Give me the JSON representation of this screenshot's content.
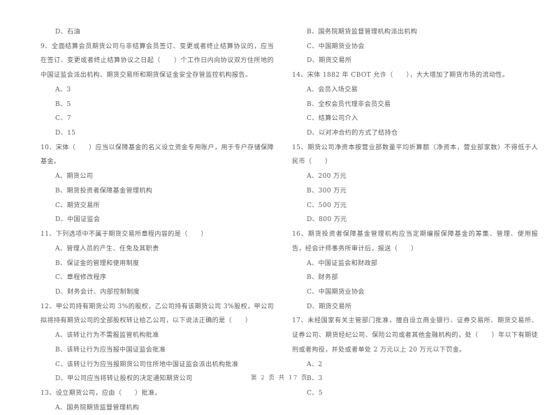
{
  "document": {
    "page_label": "第 2 页 共 17 页",
    "background_color": "#ffffff",
    "text_color": "#5a5a5a"
  },
  "left_column": {
    "items": [
      {
        "kind": "option",
        "text": "D、石油"
      },
      {
        "kind": "stem",
        "text": "9、全面结算会员期货公司与非结算会员签订、变更或者终止结算协议的，应当在签订、变更或者终止结算协议之日起（　　）个工作日内向协议双方住所地的中国证监会派出机构、期货交易所和期货保证金安全存管监控机构报告。"
      },
      {
        "kind": "option",
        "text": "A、3"
      },
      {
        "kind": "option",
        "text": "B、5"
      },
      {
        "kind": "option",
        "text": "C、7"
      },
      {
        "kind": "option",
        "text": "D、15"
      },
      {
        "kind": "stem",
        "text": "10、宋体（　　）应当以保障基金的名义设立资金专用账户，用于专户存储保障基金。"
      },
      {
        "kind": "option",
        "text": "A、期货公司"
      },
      {
        "kind": "option",
        "text": "B、期货投资者保障基金管理机构"
      },
      {
        "kind": "option",
        "text": "C、期货交易所"
      },
      {
        "kind": "option",
        "text": "D、中国证监会"
      },
      {
        "kind": "stem",
        "text": "11、下列选项中不属于期货交易所章程内容的是（　　）"
      },
      {
        "kind": "option",
        "text": "A、管理人员的产生、任免及其职责"
      },
      {
        "kind": "option",
        "text": "B、保证金的管理和使用制度"
      },
      {
        "kind": "option",
        "text": "C、章程修改程序"
      },
      {
        "kind": "option",
        "text": "D、财务会计、内部控制制度"
      },
      {
        "kind": "stem",
        "text": "12、甲公司持有期货公司 3%的股权，乙公司持有该期货公司 3%股权，甲公司拟将持有期货公司的全部股权转让给乙公司，以下说法正确的是（　　）"
      },
      {
        "kind": "option",
        "text": "A、该转让行为不需报监管机构批准"
      },
      {
        "kind": "option",
        "text": "B、该转让行为应当报中国证监会批准"
      },
      {
        "kind": "option",
        "text": "C、该转让行为应当报期货公司住所地中国证监会派出机构批准"
      },
      {
        "kind": "option",
        "text": "D、甲公司应当将转让股权的决定通知期货公司"
      },
      {
        "kind": "stem",
        "text": "13、设立期货公司，应由（　　）批准。"
      },
      {
        "kind": "option",
        "text": "A、国务院期货监督管理机构"
      }
    ]
  },
  "right_column": {
    "items": [
      {
        "kind": "option",
        "text": "B、国务院期货监督管理机构派出机构"
      },
      {
        "kind": "option",
        "text": "C、中国期货业协会"
      },
      {
        "kind": "option",
        "text": "D、期货交易所"
      },
      {
        "kind": "stem",
        "text": "14、宋体 1882 年 CBOT 允许（　　），大大增加了期货市场的流动性。"
      },
      {
        "kind": "option",
        "text": "A、会员入场交易"
      },
      {
        "kind": "option",
        "text": "B、全权会员代理非会员交易"
      },
      {
        "kind": "option",
        "text": "C、结算公司介入"
      },
      {
        "kind": "option",
        "text": "D、以对冲合约的方式了结持仓"
      },
      {
        "kind": "stem",
        "text": "15、期货公司净资本按营业部数量平均折算额（净资本，营业部家数）不得低于人民币（　　）"
      },
      {
        "kind": "option",
        "text": "A、200 万元"
      },
      {
        "kind": "option",
        "text": "B、300 万元"
      },
      {
        "kind": "option",
        "text": "C、500 万元"
      },
      {
        "kind": "option",
        "text": "D、800 万元"
      },
      {
        "kind": "stem",
        "text": "16、期货投资者保障基金管理机构应当定期编报保障基金的筹集、管理、使用报告，经会计师事务所审计后，报送（　　）"
      },
      {
        "kind": "option",
        "text": "A、中国证监会和财政部"
      },
      {
        "kind": "option",
        "text": "B、财务部"
      },
      {
        "kind": "option",
        "text": "C、中国期货业协会"
      },
      {
        "kind": "option",
        "text": "D、期货交易所"
      },
      {
        "kind": "stem",
        "text": "17、未经国家有关主管部门批准，擅自设立商业银行、证券交易所、期货交易所、证券公司、期货经纪公司、保险公司或者其他金融机构的，处（　　）年以下有期徒刑或者拘役，并处或者单处 2 万元以上 20 万元以下罚金。"
      },
      {
        "kind": "option",
        "text": "A、2"
      },
      {
        "kind": "option",
        "text": "B、3"
      },
      {
        "kind": "option",
        "text": "C、5"
      }
    ]
  }
}
